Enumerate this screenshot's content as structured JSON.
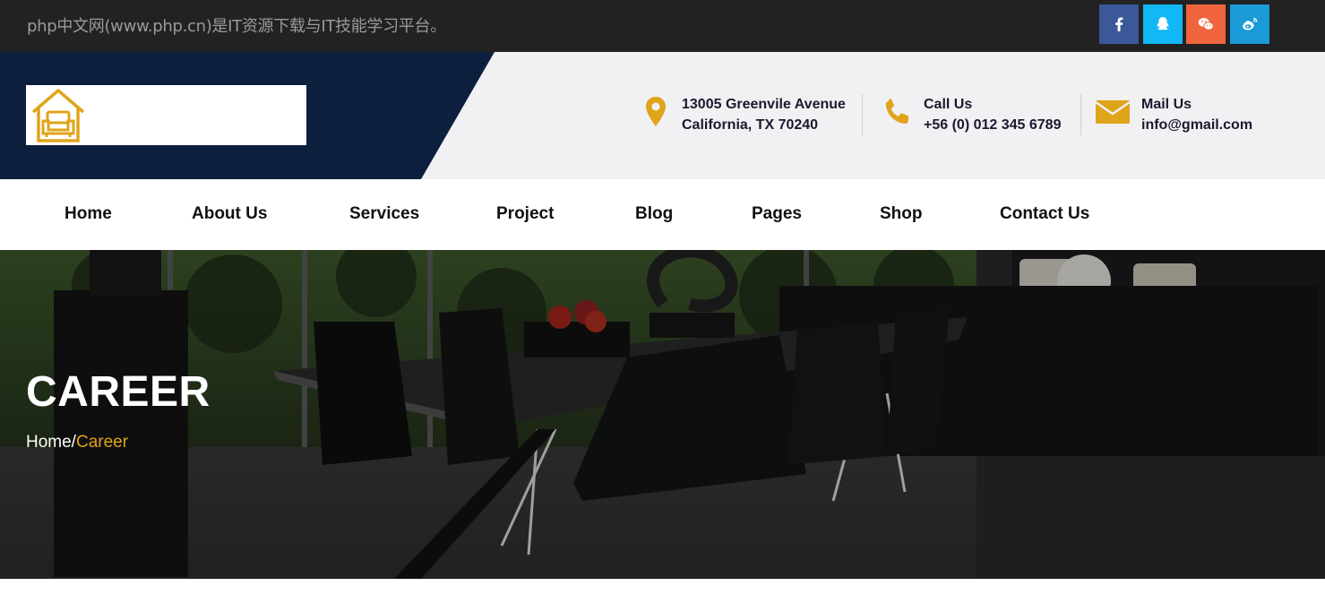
{
  "topbar": {
    "tagline": "php中文网(www.php.cn)是IT资源下载与IT技能学习平台。",
    "social": [
      {
        "icon": "facebook-icon",
        "color": "#3b5998"
      },
      {
        "icon": "qq-icon",
        "color": "#12b7f5"
      },
      {
        "icon": "wechat-icon",
        "color": "#f0653e"
      },
      {
        "icon": "weibo-icon",
        "color": "#1a9ad6"
      }
    ]
  },
  "header": {
    "logo_icon": "house-sofa-icon",
    "address": {
      "icon": "map-pin-icon",
      "line1": "13005 Greenvile Avenue",
      "line2": "California, TX 70240"
    },
    "call": {
      "icon": "phone-icon",
      "label": "Call Us",
      "value": "+56 (0) 012 345 6789"
    },
    "mail": {
      "icon": "envelope-icon",
      "label": "Mail Us",
      "value": "info@gmail.com"
    }
  },
  "nav": {
    "items": [
      "Home",
      "About Us",
      "Services",
      "Project",
      "Blog",
      "Pages",
      "Shop",
      "Contact Us"
    ]
  },
  "banner": {
    "title": "CAREER",
    "breadcrumb_home": "Home/",
    "breadcrumb_current": "Career"
  },
  "colors": {
    "navy": "#0c1f3d",
    "accent": "#e0a41a",
    "topbar": "#222222"
  }
}
